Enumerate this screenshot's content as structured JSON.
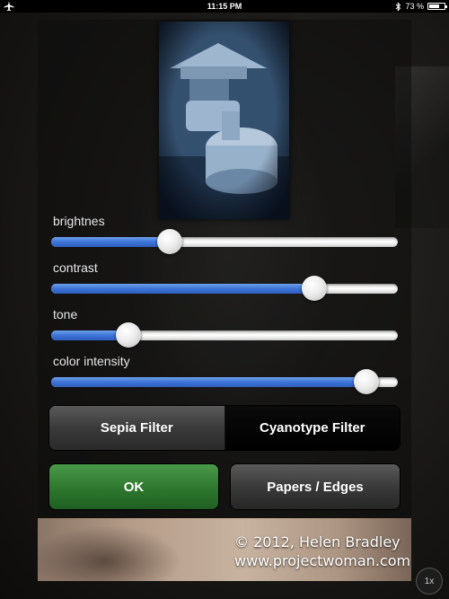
{
  "status_bar": {
    "time": "11:15 PM",
    "battery_text": "73 %",
    "battery_level": 0.73,
    "icons": [
      "airplane-icon",
      "bluetooth-icon",
      "battery-icon"
    ]
  },
  "sliders": [
    {
      "label": "brightnes",
      "value": 0.33
    },
    {
      "label": "contrast",
      "value": 0.78
    },
    {
      "label": "tone",
      "value": 0.2
    },
    {
      "label": "color intensity",
      "value": 0.94
    }
  ],
  "filters": {
    "sepia_label": "Sepia Filter",
    "cyanotype_label": "Cyanotype Filter",
    "selected": "Cyanotype Filter"
  },
  "actions": {
    "ok_label": "OK",
    "papers_label": "Papers / Edges"
  },
  "watermark": {
    "line1": "© 2012, Helen Bradley",
    "line2": "www.projectwoman.com"
  },
  "zoom_badge": "1x",
  "colors": {
    "slider_fill": "#3c73d6",
    "ok_button": "#2f7a30",
    "preview_tint": "#2c4664"
  }
}
